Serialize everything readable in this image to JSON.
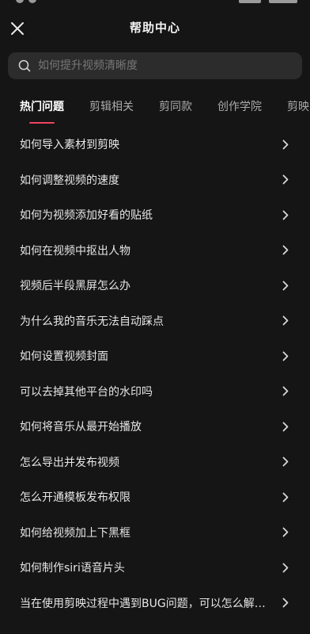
{
  "header": {
    "title": "帮助中心",
    "close_icon": "close-icon"
  },
  "search": {
    "placeholder": "如何提升视频清晰度",
    "icon": "search-icon"
  },
  "tabs": [
    {
      "label": "热门问题",
      "active": true
    },
    {
      "label": "剪辑相关",
      "active": false
    },
    {
      "label": "剪同款",
      "active": false
    },
    {
      "label": "创作学院",
      "active": false
    },
    {
      "label": "剪映",
      "active": false
    }
  ],
  "faq": {
    "items": [
      "如何导入素材到剪映",
      "如何调整视频的速度",
      "如何为视频添加好看的贴纸",
      "如何在视频中抠出人物",
      "视频后半段黑屏怎么办",
      "为什么我的音乐无法自动踩点",
      "如何设置视频封面",
      "可以去掉其他平台的水印吗",
      "如何将音乐从最开始播放",
      "怎么导出并发布视频",
      "怎么开通模板发布权限",
      "如何给视频加上下黑框",
      "如何制作siri语音片头",
      "当在使用剪映过程中遇到BUG问题，可以怎么解决？"
    ],
    "chevron_icon": "chevron-right-icon"
  },
  "colors": {
    "background": "#151515",
    "search_bg": "#2c2c2c",
    "accent": "#f0435f",
    "text_primary": "#e6e6e6",
    "text_secondary": "#aaaaaa",
    "placeholder": "#777777"
  }
}
